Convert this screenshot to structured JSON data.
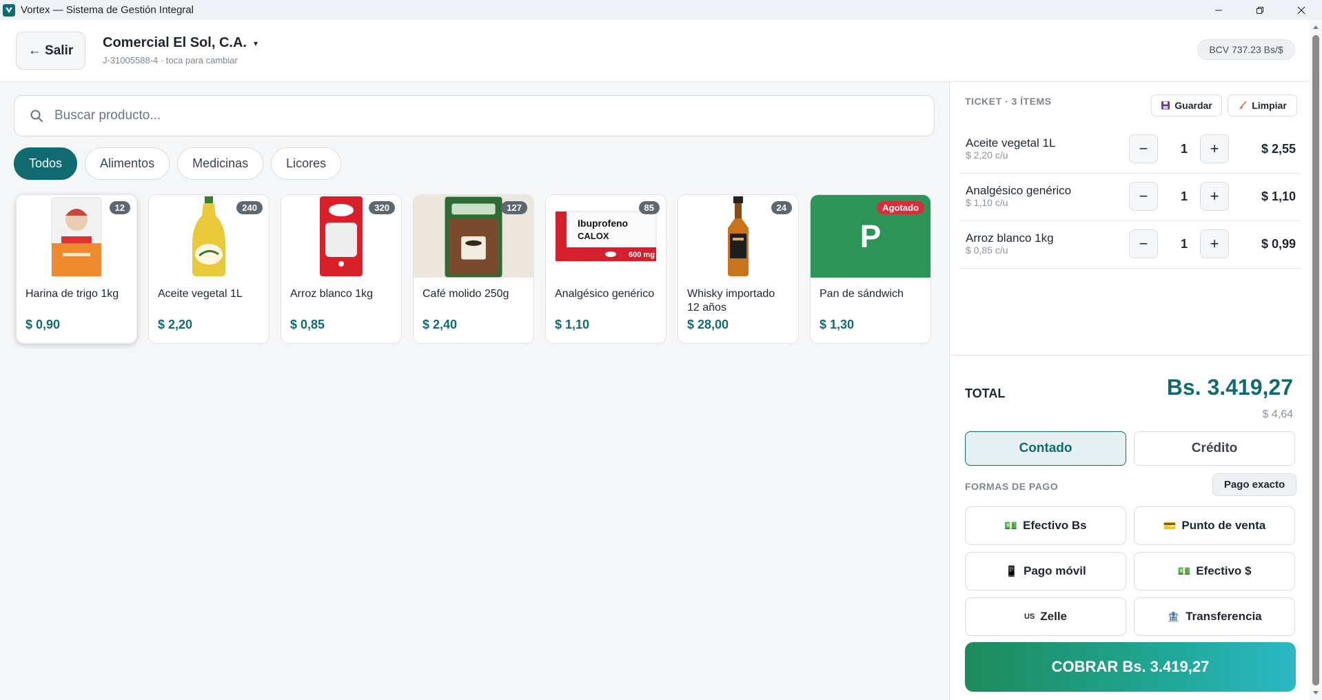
{
  "window": {
    "title": "Vortex — Sistema de Gestión Integral"
  },
  "header": {
    "back_label": "← Salir",
    "company_name": "Comercial El Sol, C.A.",
    "company_caret": "▾",
    "company_sub": "J-31005588-4 · toca para cambiar",
    "rate": "BCV 737.23 Bs/$"
  },
  "search": {
    "placeholder": "Buscar producto..."
  },
  "categories": [
    {
      "label": "Todos",
      "active": true
    },
    {
      "label": "Alimentos",
      "active": false
    },
    {
      "label": "Medicinas",
      "active": false
    },
    {
      "label": "Licores",
      "active": false
    }
  ],
  "products": [
    {
      "name": "Harina de trigo 1kg",
      "price": "$ 0,90",
      "stock": "12",
      "thumb": "bag-orange"
    },
    {
      "name": "Aceite vegetal 1L",
      "price": "$ 2,20",
      "stock": "240",
      "thumb": "bottle-oil"
    },
    {
      "name": "Arroz blanco 1kg",
      "price": "$ 0,85",
      "stock": "320",
      "thumb": "bag-red"
    },
    {
      "name": "Café molido 250g",
      "price": "$ 2,40",
      "stock": "127",
      "thumb": "coffee-bag"
    },
    {
      "name": "Analgésico genérico",
      "price": "$ 1,10",
      "stock": "85",
      "thumb": "pill-box",
      "box_text1": "Ibuprofeno",
      "box_text2": "CALOX",
      "box_dose": "600 mg"
    },
    {
      "name": "Whisky importado 12 años",
      "price": "$ 28,00",
      "stock": "24",
      "thumb": "whisky-bottle"
    },
    {
      "name": "Pan de sándwich",
      "price": "$ 1,30",
      "stock": "Agotado",
      "thumb": "letter",
      "letter": "P"
    }
  ],
  "ticket": {
    "heading": "TICKET · 3 ÍTEMS",
    "save_label": "Guardar",
    "clear_label": "Limpiar",
    "minus": "−",
    "plus": "+",
    "items": [
      {
        "name": "Aceite vegetal 1L",
        "unit": "$ 2,20 c/u",
        "qty": "1",
        "total": "$ 2,55"
      },
      {
        "name": "Analgésico genérico",
        "unit": "$ 1,10 c/u",
        "qty": "1",
        "total": "$ 1,10"
      },
      {
        "name": "Arroz blanco 1kg",
        "unit": "$ 0,85 c/u",
        "qty": "1",
        "total": "$ 0,99"
      }
    ]
  },
  "summary": {
    "total_label": "TOTAL",
    "total_bs": "Bs. 3.419,27",
    "total_usd": "$ 4,64",
    "mode_cash": "Contado",
    "mode_credit": "Crédito",
    "payments_label": "FORMAS DE PAGO",
    "exact_label": "Pago exacto",
    "payments": [
      {
        "label": "Efectivo Bs",
        "icon": "💵"
      },
      {
        "label": "Punto de venta",
        "icon": "💳"
      },
      {
        "label": "Pago móvil",
        "icon": "📱"
      },
      {
        "label": "Efectivo $",
        "icon": "💵"
      },
      {
        "label": "Zelle",
        "icon": "US"
      },
      {
        "label": "Transferencia",
        "icon": "🏦"
      }
    ],
    "charge_label": "COBRAR Bs. 3.419,27"
  },
  "colors": {
    "accent": "#0f6b70",
    "sold_out": "#d62f3a",
    "pay_gradient_start": "#1e8a5b",
    "pay_gradient_end": "#2ab9c5"
  }
}
